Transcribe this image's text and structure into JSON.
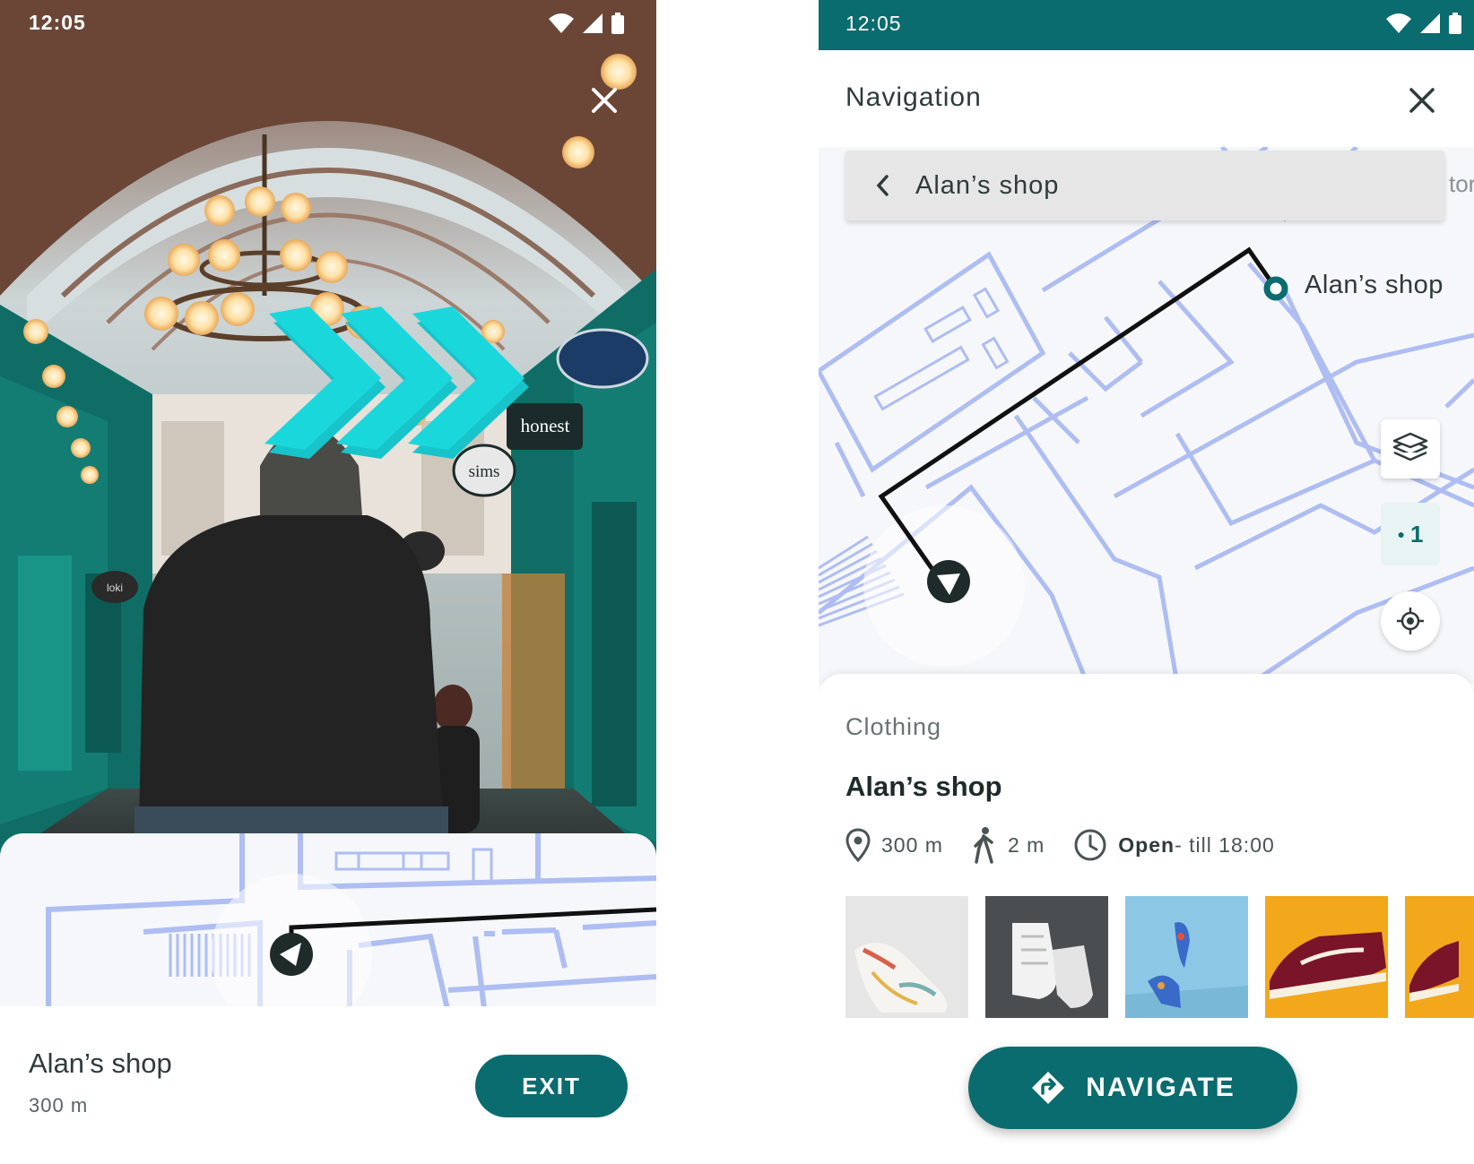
{
  "ar_screen": {
    "status_time": "12:05",
    "destination_name": "Alan’s shop",
    "destination_distance": "300 m",
    "exit_label": "EXIT",
    "photo_signs": [
      "honest",
      "sims",
      "loki"
    ]
  },
  "nav_screen": {
    "status_time": "12:05",
    "title": "Navigation",
    "search_value": "Alan’s shop",
    "search_peek": "tor",
    "map_destination_label": "Alan’s shop",
    "floor_label": "1",
    "place": {
      "category": "Clothing",
      "name": "Alan’s shop",
      "distance": "300 m",
      "walk_time": "2 m",
      "open_status": "Open",
      "open_until": " - till 18:00"
    },
    "navigate_label": "NAVIGATE"
  },
  "icons": [
    "close-icon",
    "chevron-left-icon",
    "layers-icon",
    "my-location-icon",
    "location-pin-icon",
    "walking-icon",
    "clock-icon",
    "directions-icon",
    "wifi-icon",
    "signal-icon",
    "battery-icon",
    "user-location-icon"
  ],
  "colors": {
    "accent": "#0a6c6e",
    "route": "#111111",
    "floorplan": "#aebdf2",
    "ar_arrow": "#1ad7dc"
  }
}
